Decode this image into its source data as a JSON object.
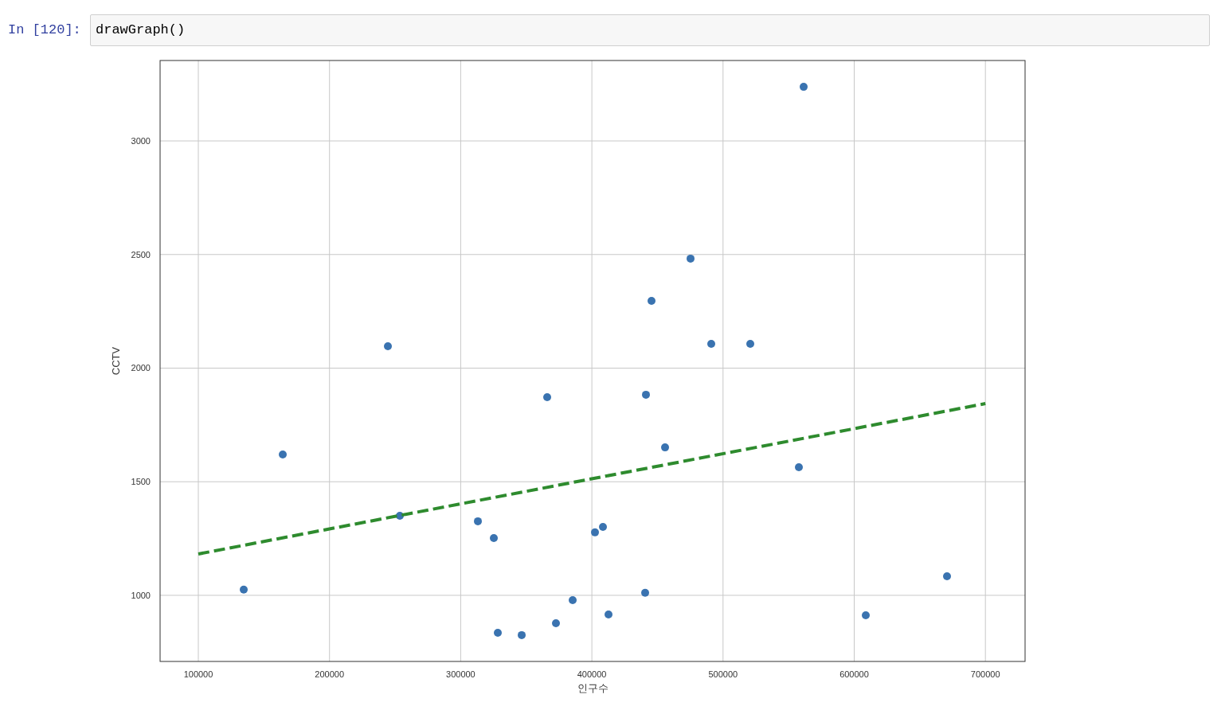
{
  "cell": {
    "prompt": "In [120]:",
    "code": "drawGraph()"
  },
  "output": {
    "chart_data": {
      "type": "scatter",
      "xlabel": "인구수",
      "ylabel": "CCTV",
      "xlim": [
        70850,
        730240
      ],
      "ylim": [
        709,
        3354
      ],
      "xticks": [
        100000,
        200000,
        300000,
        400000,
        500000,
        600000,
        700000
      ],
      "yticks": [
        1000,
        1500,
        2000,
        2500,
        3000
      ],
      "grid": true,
      "series": [
        {
          "type": "scatter",
          "color": "#3a73b0",
          "x": [
            561445,
            475230,
            445476,
            244505,
            491017,
            520765,
            365938,
            441226,
            164360,
            455798,
            557802,
            253613,
            313115,
            325258,
            408440,
            402368,
            134608,
            670735,
            440619,
            385367,
            412689,
            608804,
            372617,
            328294,
            346509
          ],
          "values": [
            3238,
            2482,
            2296,
            2096,
            2107,
            2107,
            1872,
            1883,
            1620,
            1651,
            1564,
            1350,
            1326,
            1252,
            1301,
            1277,
            1025,
            1084,
            1011,
            979,
            916,
            912,
            877,
            835,
            825
          ]
        },
        {
          "type": "line",
          "line_style": "dashed",
          "color": "#2e8b2e",
          "x": [
            100000,
            700000
          ],
          "values": [
            1182,
            1844
          ]
        }
      ]
    }
  }
}
